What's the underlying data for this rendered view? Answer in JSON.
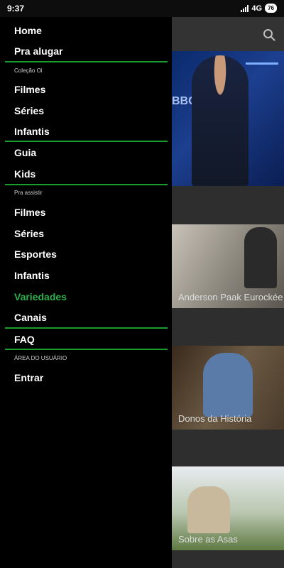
{
  "status_bar": {
    "time": "9:37",
    "network": "4G",
    "battery": "76"
  },
  "icons": {
    "search": "search-icon",
    "signal": "signal-icon",
    "battery": "battery-icon"
  },
  "colors": {
    "accent": "#1a9c2e",
    "active_text": "#2bb24a",
    "drawer_bg": "#000000",
    "content_bg": "#2e2e2e"
  },
  "drawer": {
    "items_top": [
      {
        "label": "Home"
      },
      {
        "label": "Pra alugar"
      }
    ],
    "section_colecao": "Coleção Oi",
    "items_colecao": [
      {
        "label": "Filmes"
      },
      {
        "label": "Séries"
      },
      {
        "label": "Infantis"
      }
    ],
    "items_mid": [
      {
        "label": "Guia"
      },
      {
        "label": "Kids"
      }
    ],
    "section_assistir": "Pra assistir",
    "items_assistir": [
      {
        "label": "Filmes"
      },
      {
        "label": "Séries"
      },
      {
        "label": "Esportes"
      },
      {
        "label": "Infantis"
      },
      {
        "label": "Variedades",
        "active": true
      },
      {
        "label": "Canais"
      }
    ],
    "item_faq": "FAQ",
    "section_usuario": "ÁREA DO USUÁRIO",
    "item_login": "Entrar"
  },
  "content": {
    "hero_overlay_text": "BBC",
    "cards": [
      {
        "title": "Anderson Paak Eurockée"
      },
      {
        "title": "Donos da História"
      },
      {
        "title": "Sobre as Asas"
      }
    ]
  }
}
